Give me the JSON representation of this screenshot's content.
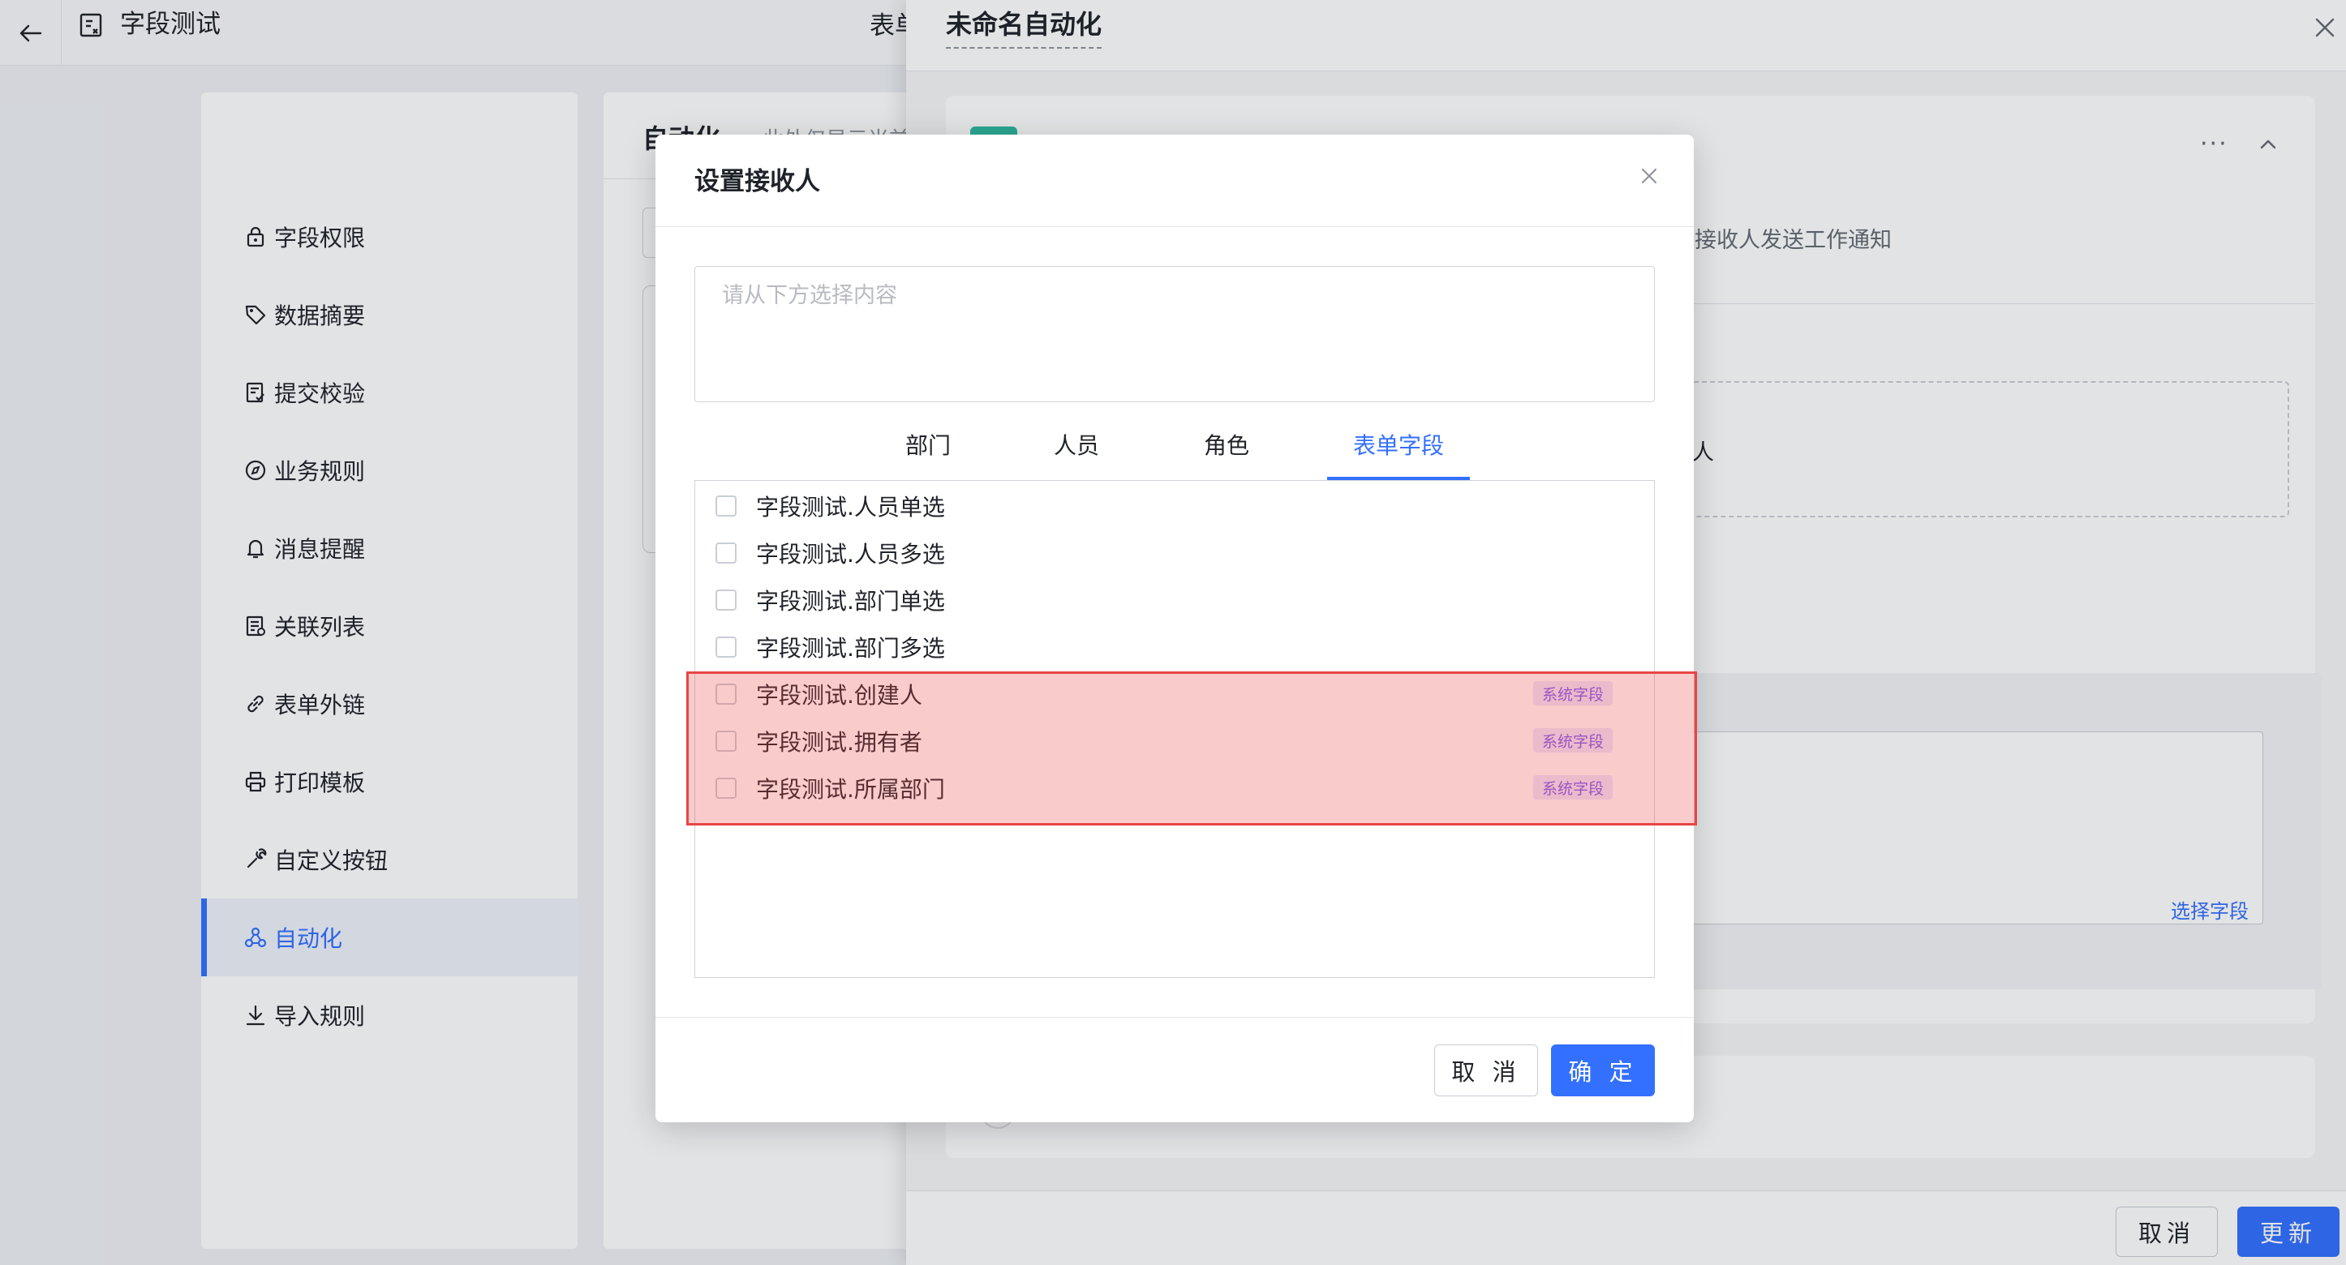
{
  "header": {
    "app_title": "字段测试",
    "top_tab": "表单"
  },
  "sidebar": {
    "items": [
      {
        "label": "字段权限",
        "icon": "lock-icon"
      },
      {
        "label": "数据摘要",
        "icon": "tag-icon"
      },
      {
        "label": "提交校验",
        "icon": "document-check-icon"
      },
      {
        "label": "业务规则",
        "icon": "compass-icon"
      },
      {
        "label": "消息提醒",
        "icon": "bell-icon"
      },
      {
        "label": "关联列表",
        "icon": "list-icon"
      },
      {
        "label": "表单外链",
        "icon": "link-icon"
      },
      {
        "label": "打印模板",
        "icon": "printer-icon"
      },
      {
        "label": "自定义按钮",
        "icon": "wrench-icon"
      },
      {
        "label": "自动化",
        "icon": "flow-icon",
        "active": true
      },
      {
        "label": "导入规则",
        "icon": "download-icon"
      }
    ]
  },
  "middle": {
    "title": "自动化",
    "hint": "此处仅显示当前"
  },
  "drawer": {
    "title": "未命名自动化",
    "description": "向接收人发送工作通知",
    "receiver_text": "人",
    "select_field": "选择字段",
    "cancel": "取消",
    "update": "更新"
  },
  "modal": {
    "title": "设置接收人",
    "placeholder": "请从下方选择内容",
    "tabs": [
      "部门",
      "人员",
      "角色",
      "表单字段"
    ],
    "active_tab": "表单字段",
    "items": [
      {
        "label": "字段测试.人员单选",
        "checked": false,
        "tag": ""
      },
      {
        "label": "字段测试.人员多选",
        "checked": false,
        "tag": ""
      },
      {
        "label": "字段测试.部门单选",
        "checked": false,
        "tag": ""
      },
      {
        "label": "字段测试.部门多选",
        "checked": false,
        "tag": ""
      },
      {
        "label": "字段测试.创建人",
        "checked": false,
        "tag": "系统字段"
      },
      {
        "label": "字段测试.拥有者",
        "checked": false,
        "tag": "系统字段"
      },
      {
        "label": "字段测试.所属部门",
        "checked": false,
        "tag": "系统字段"
      }
    ],
    "cancel": "取 消",
    "ok": "确 定"
  },
  "colors": {
    "accent": "#3370ff",
    "highlight": "#e84545",
    "tag_text": "#7b5cf5",
    "tag_bg": "#ece8ff",
    "badge": "#2fb99f"
  }
}
